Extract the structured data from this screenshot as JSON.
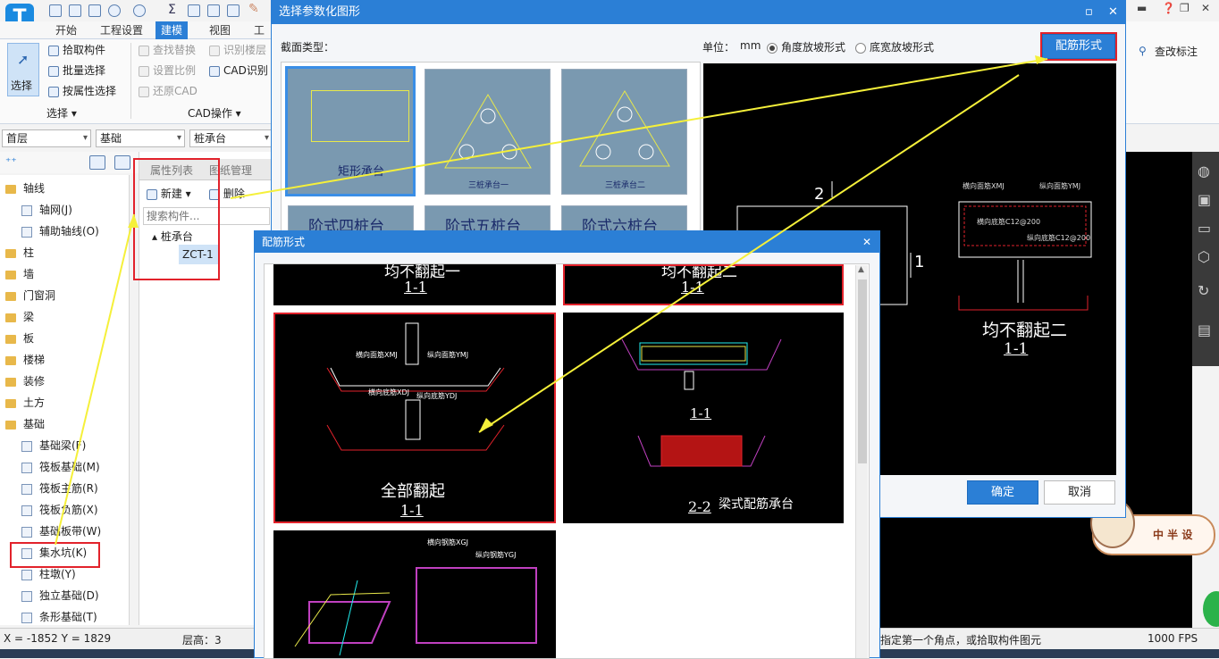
{
  "app": {
    "logo_letter": "T"
  },
  "ribbon": {
    "tabs": [
      "开始",
      "工程设置",
      "建模",
      "视图",
      "工具"
    ],
    "active_tab": "建模",
    "select_label": "选择",
    "pick_label": "拾取构件",
    "batch_label": "批量选择",
    "byprop_label": "按属性选择",
    "find_replace": "查找替换",
    "set_scale": "设置比例",
    "restore_cad": "还原CAD",
    "identify_floor": "识别楼层",
    "cad_identify": "CAD识别",
    "group_select": "选择",
    "group_cad": "CAD操作",
    "right_label": "查改标注"
  },
  "filters": {
    "floor": "首层",
    "category": "基础",
    "type": "桩承台"
  },
  "tree": {
    "items": [
      {
        "label": "轴线",
        "kind": "folder"
      },
      {
        "label": "轴网(J)",
        "kind": "leaf"
      },
      {
        "label": "辅助轴线(O)",
        "kind": "leaf"
      },
      {
        "label": "柱",
        "kind": "folder"
      },
      {
        "label": "墙",
        "kind": "folder"
      },
      {
        "label": "门窗洞",
        "kind": "folder"
      },
      {
        "label": "梁",
        "kind": "folder"
      },
      {
        "label": "板",
        "kind": "folder"
      },
      {
        "label": "楼梯",
        "kind": "folder"
      },
      {
        "label": "装修",
        "kind": "folder"
      },
      {
        "label": "土方",
        "kind": "folder"
      },
      {
        "label": "基础",
        "kind": "folder"
      },
      {
        "label": "基础梁(F)",
        "kind": "leaf"
      },
      {
        "label": "筏板基础(M)",
        "kind": "leaf"
      },
      {
        "label": "筏板主筋(R)",
        "kind": "leaf"
      },
      {
        "label": "筏板负筋(X)",
        "kind": "leaf"
      },
      {
        "label": "基础板带(W)",
        "kind": "leaf"
      },
      {
        "label": "集水坑(K)",
        "kind": "leaf"
      },
      {
        "label": "柱墩(Y)",
        "kind": "leaf"
      },
      {
        "label": "独立基础(D)",
        "kind": "leaf"
      },
      {
        "label": "条形基础(T)",
        "kind": "leaf"
      }
    ]
  },
  "midpanel": {
    "tabs": [
      "属性列表",
      "图纸管理"
    ],
    "new_label": "新建",
    "delete_label": "删除",
    "search_placeholder": "搜索构件...",
    "node_parent": "桩承台",
    "node_child": "ZCT-1"
  },
  "status": {
    "coords": "X = -1852 Y = 1829",
    "floor_height": "层高：3",
    "hint": "指定第一个角点，或拾取构件图元",
    "fps": "1000 FPS"
  },
  "dialog1": {
    "title": "选择参数化图形",
    "section_label": "截面类型：",
    "unit_label": "单位：",
    "unit_value": "mm",
    "radio1": "角度放坡形式",
    "radio2": "底宽放坡形式",
    "config_button": "配筋形式",
    "thumbs": [
      {
        "label": "矩形承台"
      },
      {
        "label": "三桩承台一"
      },
      {
        "label": "三桩承台二"
      },
      {
        "label": "阶式四桩台"
      },
      {
        "label": "阶式五桩台"
      },
      {
        "label": "阶式六桩台"
      }
    ],
    "preview_caption": "均不翻起二",
    "preview_sub": "1-1",
    "preview_num2": "2",
    "preview_num1": "1",
    "ok_button": "确定",
    "cancel_button": "取消"
  },
  "dialog2": {
    "title": "配筋形式",
    "cards": [
      {
        "caption": "均不翻起一",
        "sub": "1-1"
      },
      {
        "caption": "均不翻起二",
        "sub": "1-1"
      },
      {
        "caption": "全部翻起",
        "sub": "1-1"
      },
      {
        "caption": "梁式配筋承台",
        "sub": "2-2",
        "sub1": "1-1"
      }
    ],
    "annot_top": "横向面筋XMJ",
    "annot_top2": "纵向面筋YMJ",
    "annot_bot": "横向底筋XDJ",
    "annot_bot2": "纵向底筋YDJ",
    "annot_xgj": "横向钢筋XGJ",
    "annot_ygj": "纵向钢筋YGJ"
  },
  "preview_annots": {
    "xmj": "横向面筋XMJ",
    "ymj": "纵向面筋YMJ",
    "xdj": "横向底筋C12@200",
    "ydj": "纵向底筋C12@200"
  },
  "mascot": {
    "text": "中 半 设"
  }
}
